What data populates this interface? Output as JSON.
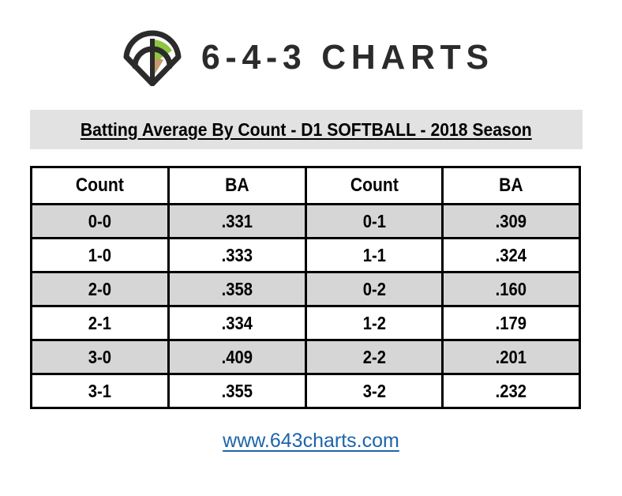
{
  "brand": {
    "logo_icon": "baseball-diamond-logo-icon",
    "wordmark": "6-4-3 CHARTS",
    "colors": {
      "dark": "#2b2b2b",
      "green_wedge": "#8dc63f",
      "tan_wedge": "#c49a6c"
    }
  },
  "title": {
    "text": "Batting Average By Count - D1 SOFTBALL - 2018 Season",
    "band_background": "#e2e2e2"
  },
  "table": {
    "headers": [
      "Count",
      "BA",
      "Count",
      "BA"
    ],
    "rows": [
      [
        "0-0",
        ".331",
        "0-1",
        ".309"
      ],
      [
        "1-0",
        ".333",
        "1-1",
        ".324"
      ],
      [
        "2-0",
        ".358",
        "0-2",
        ".160"
      ],
      [
        "2-1",
        ".334",
        "1-2",
        ".179"
      ],
      [
        "3-0",
        ".409",
        "2-2",
        ".201"
      ],
      [
        "3-1",
        ".355",
        "3-2",
        ".232"
      ]
    ],
    "shaded_row_color": "#d6d6d6"
  },
  "footer": {
    "link_text": "www.643charts.com",
    "link_color": "#1c65ab"
  },
  "chart_data": {
    "type": "table",
    "title": "Batting Average By Count - D1 SOFTBALL - 2018 Season",
    "xlabel": "Count",
    "ylabel": "Batting Average",
    "categories": [
      "0-0",
      "1-0",
      "2-0",
      "2-1",
      "3-0",
      "3-1",
      "0-1",
      "1-1",
      "0-2",
      "1-2",
      "2-2",
      "3-2"
    ],
    "values": [
      0.331,
      0.333,
      0.358,
      0.334,
      0.409,
      0.355,
      0.309,
      0.324,
      0.16,
      0.179,
      0.201,
      0.232
    ],
    "series": [
      {
        "name": "Batting Average",
        "values": [
          0.331,
          0.333,
          0.358,
          0.334,
          0.409,
          0.355,
          0.309,
          0.324,
          0.16,
          0.179,
          0.201,
          0.232
        ]
      }
    ],
    "columns": [
      "Count",
      "BA",
      "Count",
      "BA"
    ],
    "rows": [
      [
        "0-0",
        ".331",
        "0-1",
        ".309"
      ],
      [
        "1-0",
        ".333",
        "1-1",
        ".324"
      ],
      [
        "2-0",
        ".358",
        "0-2",
        ".160"
      ],
      [
        "2-1",
        ".334",
        "1-2",
        ".179"
      ],
      [
        "3-0",
        ".409",
        "2-2",
        ".201"
      ],
      [
        "3-1",
        ".355",
        "3-2",
        ".232"
      ]
    ],
    "grid": true,
    "legend": "none"
  }
}
